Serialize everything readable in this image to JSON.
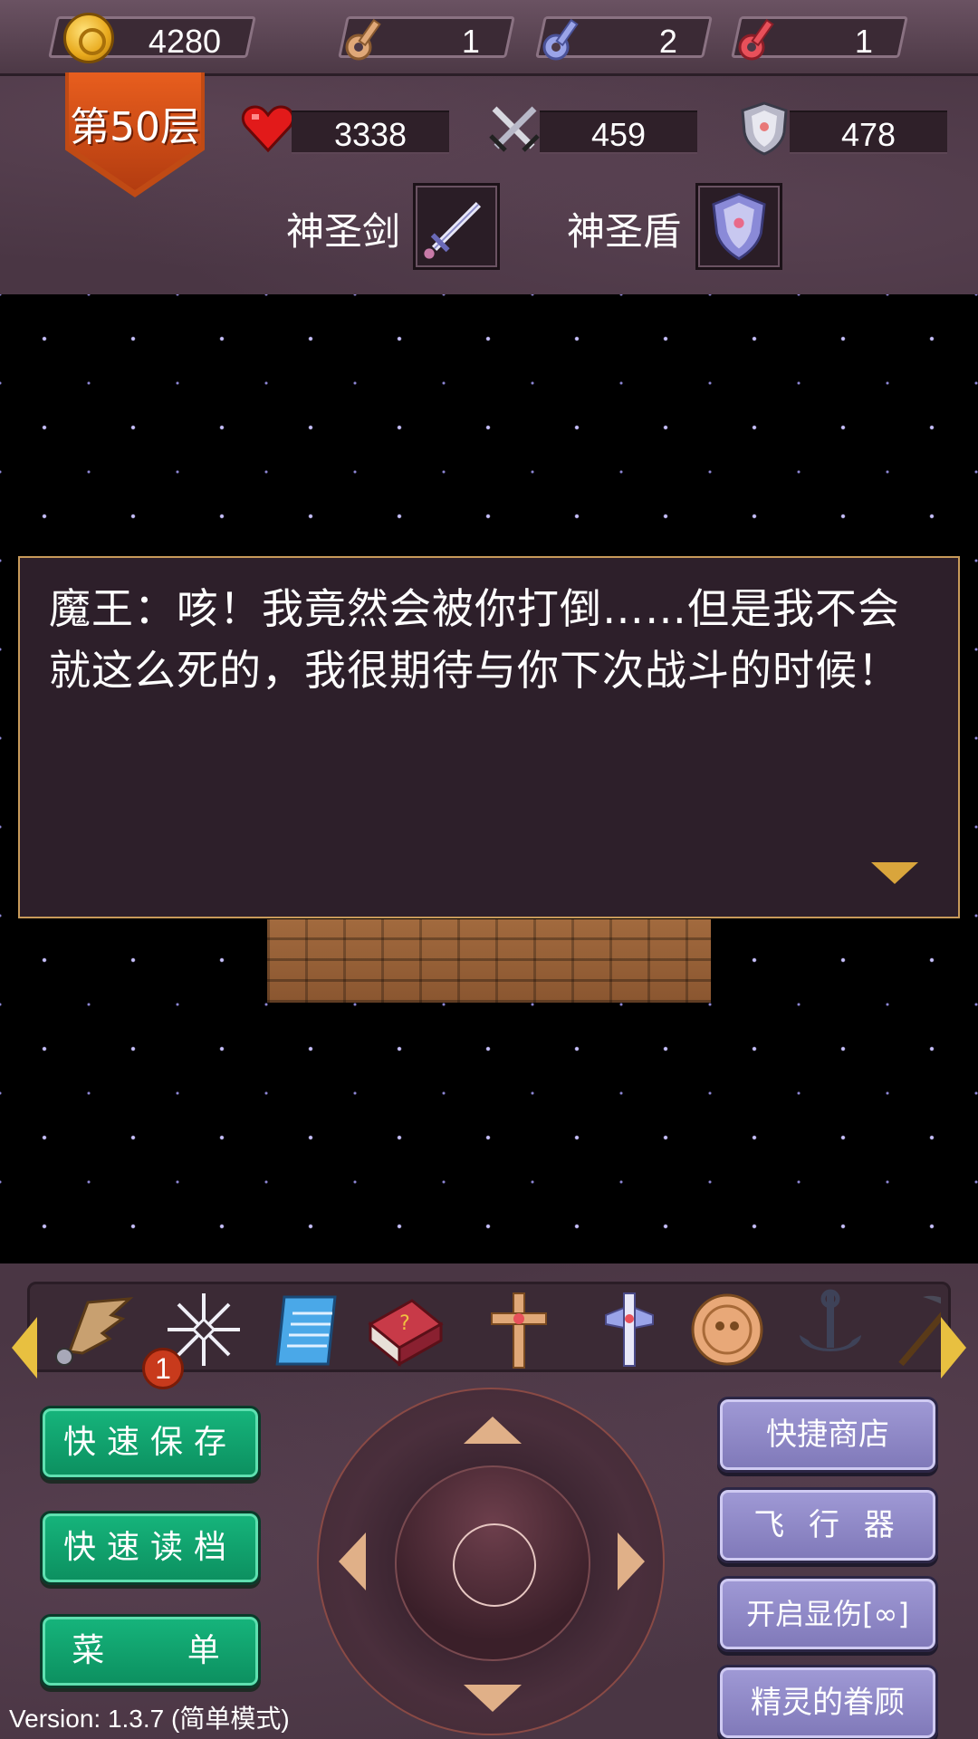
{
  "resources": {
    "gold": "4280",
    "yellow_keys": "1",
    "blue_keys": "2",
    "red_keys": "1"
  },
  "floor": "第50层",
  "stats": {
    "hp": "3338",
    "attack": "459",
    "defense": "478"
  },
  "equipment": {
    "weapon": "神圣剑",
    "shield": "神圣盾"
  },
  "dialog": {
    "text": "魔王：咳！我竟然会被你打倒……但是我不会就这么死的，我很期待与你下次战斗的时候！"
  },
  "items": {
    "badge_count": "1"
  },
  "buttons": {
    "quick_save": "快速保存",
    "quick_load": "快速读档",
    "menu": "菜 单",
    "quick_shop": "快捷商店",
    "fly": "飞 行 器",
    "damage_display": "开启显伤[∞]",
    "fairy": "精灵的眷顾"
  },
  "version": "Version: 1.3.7 (简单模式)",
  "colors": {
    "gold": "#e8a91c",
    "yellow_key": "#e0a878",
    "blue_key": "#9aa4e8",
    "red_key": "#e8505a",
    "green_button": "#0c8f5f",
    "purple_button": "#8f88c8"
  }
}
